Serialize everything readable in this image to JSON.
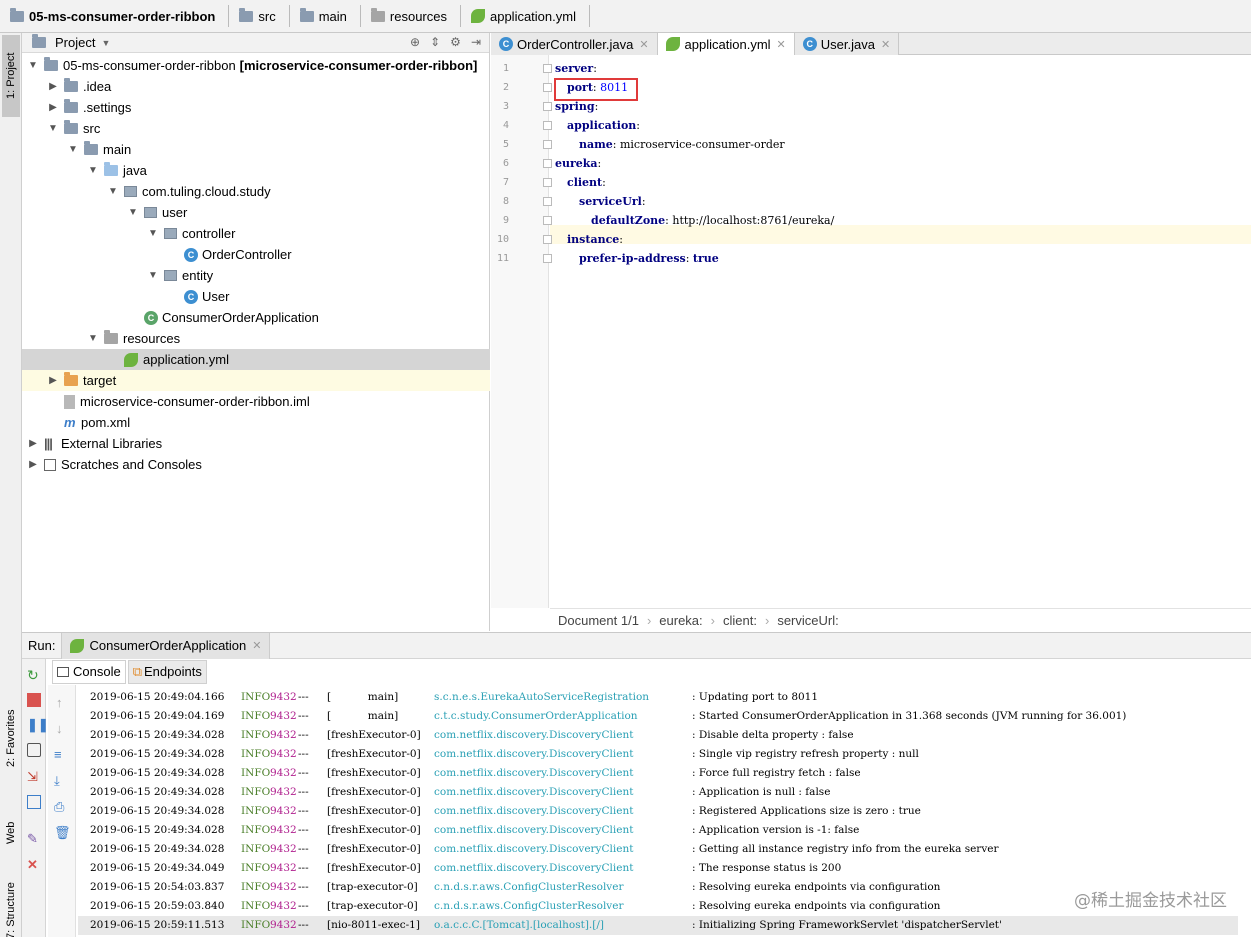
{
  "breadcrumbs": [
    {
      "label": "05-ms-consumer-order-ribbon",
      "icon": "module-folder-icon",
      "bold": true
    },
    {
      "label": "src",
      "icon": "folder-icon"
    },
    {
      "label": "main",
      "icon": "folder-icon"
    },
    {
      "label": "resources",
      "icon": "resources-folder-icon"
    },
    {
      "label": "application.yml",
      "icon": "spring-leaf-icon"
    }
  ],
  "sidebar_tabs": {
    "project": "1: Project",
    "favorites": "2: Favorites",
    "web": "Web",
    "structure": "7: Structure"
  },
  "project_panel": {
    "title": "Project",
    "tree": [
      {
        "label": "05-ms-consumer-order-ribbon",
        "suffix": "[microservice-consumer-order-ribbon]",
        "arrow": "open",
        "icon": "module"
      },
      {
        "label": ".idea",
        "arrow": "closed",
        "icon": "folder"
      },
      {
        "label": ".settings",
        "arrow": "closed",
        "icon": "folder"
      },
      {
        "label": "src",
        "arrow": "open",
        "icon": "folder"
      },
      {
        "label": "main",
        "arrow": "open",
        "icon": "folder"
      },
      {
        "label": "java",
        "arrow": "open",
        "icon": "source-folder"
      },
      {
        "label": "com.tuling.cloud.study",
        "arrow": "open",
        "icon": "package"
      },
      {
        "label": "user",
        "arrow": "open",
        "icon": "package"
      },
      {
        "label": "controller",
        "arrow": "open",
        "icon": "package"
      },
      {
        "label": "OrderController",
        "arrow": "",
        "icon": "class"
      },
      {
        "label": "entity",
        "arrow": "open",
        "icon": "package"
      },
      {
        "label": "User",
        "arrow": "",
        "icon": "class"
      },
      {
        "label": "ConsumerOrderApplication",
        "arrow": "",
        "icon": "spring-class"
      },
      {
        "label": "resources",
        "arrow": "open",
        "icon": "resources-folder"
      },
      {
        "label": "application.yml",
        "arrow": "",
        "icon": "spring-leaf"
      },
      {
        "label": "target",
        "arrow": "closed",
        "icon": "excluded-folder"
      },
      {
        "label": "microservice-consumer-order-ribbon.iml",
        "arrow": "",
        "icon": "iml-file"
      },
      {
        "label": "pom.xml",
        "arrow": "",
        "icon": "maven"
      },
      {
        "label": "External Libraries",
        "arrow": "closed",
        "icon": "libraries"
      },
      {
        "label": "Scratches and Consoles",
        "arrow": "closed",
        "icon": "scratches"
      }
    ]
  },
  "editor": {
    "tabs": [
      {
        "label": "OrderController.java",
        "icon": "class",
        "active": false
      },
      {
        "label": "application.yml",
        "icon": "spring-leaf",
        "active": true
      },
      {
        "label": "User.java",
        "icon": "class",
        "active": false
      }
    ],
    "lines": [
      {
        "n": "1",
        "key": "server",
        "sep": ":",
        "val": ""
      },
      {
        "n": "2",
        "key": "port",
        "sep": ": ",
        "val": "8011"
      },
      {
        "n": "3",
        "key": "spring",
        "sep": ":",
        "val": ""
      },
      {
        "n": "4",
        "key": "application",
        "sep": ":",
        "val": ""
      },
      {
        "n": "5",
        "key": "name",
        "sep": ": ",
        "val": "microservice-consumer-order"
      },
      {
        "n": "6",
        "key": "eureka",
        "sep": ":",
        "val": ""
      },
      {
        "n": "7",
        "key": "client",
        "sep": ":",
        "val": ""
      },
      {
        "n": "8",
        "key": "serviceUrl",
        "sep": ":",
        "val": ""
      },
      {
        "n": "9",
        "key": "defaultZone",
        "sep": ": ",
        "val": "http://localhost:8761/eureka/"
      },
      {
        "n": "10",
        "key": "instance",
        "sep": ":",
        "val": ""
      },
      {
        "n": "11",
        "key": "prefer-ip-address",
        "sep": ": ",
        "val": "true"
      }
    ],
    "status": {
      "document": "Document 1/1",
      "path": [
        "eureka:",
        "client:",
        "serviceUrl:"
      ]
    }
  },
  "run_panel": {
    "label": "Run:",
    "config_tab": "ConsumerOrderApplication",
    "sub_tabs": [
      "Console",
      "Endpoints"
    ],
    "log": [
      {
        "ts": "2019-06-15 20:49:04.166",
        "lvl": "INFO",
        "pid": "9432",
        "dash": "---",
        "thr": "[           main]",
        "cls": "s.c.n.e.s.EurekaAutoServiceRegistration",
        "msg": ": Updating port to 8011"
      },
      {
        "ts": "2019-06-15 20:49:04.169",
        "lvl": "INFO",
        "pid": "9432",
        "dash": "---",
        "thr": "[           main]",
        "cls": "c.t.c.study.ConsumerOrderApplication",
        "msg": ": Started ConsumerOrderApplication in 31.368 seconds (JVM running for 36.001)"
      },
      {
        "ts": "2019-06-15 20:49:34.028",
        "lvl": "INFO",
        "pid": "9432",
        "dash": "---",
        "thr": "[freshExecutor-0]",
        "cls": "com.netflix.discovery.DiscoveryClient",
        "msg": ": Disable delta property : false"
      },
      {
        "ts": "2019-06-15 20:49:34.028",
        "lvl": "INFO",
        "pid": "9432",
        "dash": "---",
        "thr": "[freshExecutor-0]",
        "cls": "com.netflix.discovery.DiscoveryClient",
        "msg": ": Single vip registry refresh property : null"
      },
      {
        "ts": "2019-06-15 20:49:34.028",
        "lvl": "INFO",
        "pid": "9432",
        "dash": "---",
        "thr": "[freshExecutor-0]",
        "cls": "com.netflix.discovery.DiscoveryClient",
        "msg": ": Force full registry fetch : false"
      },
      {
        "ts": "2019-06-15 20:49:34.028",
        "lvl": "INFO",
        "pid": "9432",
        "dash": "---",
        "thr": "[freshExecutor-0]",
        "cls": "com.netflix.discovery.DiscoveryClient",
        "msg": ": Application is null : false"
      },
      {
        "ts": "2019-06-15 20:49:34.028",
        "lvl": "INFO",
        "pid": "9432",
        "dash": "---",
        "thr": "[freshExecutor-0]",
        "cls": "com.netflix.discovery.DiscoveryClient",
        "msg": ": Registered Applications size is zero : true"
      },
      {
        "ts": "2019-06-15 20:49:34.028",
        "lvl": "INFO",
        "pid": "9432",
        "dash": "---",
        "thr": "[freshExecutor-0]",
        "cls": "com.netflix.discovery.DiscoveryClient",
        "msg": ": Application version is -1: false"
      },
      {
        "ts": "2019-06-15 20:49:34.028",
        "lvl": "INFO",
        "pid": "9432",
        "dash": "---",
        "thr": "[freshExecutor-0]",
        "cls": "com.netflix.discovery.DiscoveryClient",
        "msg": ": Getting all instance registry info from the eureka server"
      },
      {
        "ts": "2019-06-15 20:49:34.049",
        "lvl": "INFO",
        "pid": "9432",
        "dash": "---",
        "thr": "[freshExecutor-0]",
        "cls": "com.netflix.discovery.DiscoveryClient",
        "msg": ": The response status is 200"
      },
      {
        "ts": "2019-06-15 20:54:03.837",
        "lvl": "INFO",
        "pid": "9432",
        "dash": "---",
        "thr": "[trap-executor-0]",
        "cls": "c.n.d.s.r.aws.ConfigClusterResolver",
        "msg": ": Resolving eureka endpoints via configuration"
      },
      {
        "ts": "2019-06-15 20:59:03.840",
        "lvl": "INFO",
        "pid": "9432",
        "dash": "---",
        "thr": "[trap-executor-0]",
        "cls": "c.n.d.s.r.aws.ConfigClusterResolver",
        "msg": ": Resolving eureka endpoints via configuration"
      },
      {
        "ts": "2019-06-15 20:59:11.513",
        "lvl": "INFO",
        "pid": "9432",
        "dash": "---",
        "thr": "[nio-8011-exec-1]",
        "cls": "o.a.c.c.C.[Tomcat].[localhost].[/]",
        "msg": ": Initializing Spring FrameworkServlet 'dispatcherServlet'"
      }
    ]
  },
  "watermark": "@稀土掘金技术社区",
  "colors": {
    "highlight_box": "#e03a3a",
    "yaml_key": "#000080",
    "number": "#0000ff",
    "log_class": "#2aa0b5",
    "log_pid": "#b0208e",
    "log_level": "#4b7f2a"
  }
}
